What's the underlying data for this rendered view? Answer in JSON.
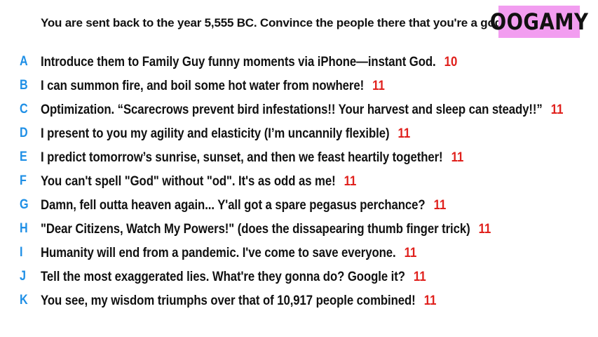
{
  "prompt": "You are sent back to the year 5,555 BC. Convince the people there that you're a god.",
  "logo": "OOGAMY",
  "colors": {
    "letter": "#1e8fe6",
    "score": "#e0201c",
    "logo_background": "#f29df0"
  },
  "answers": [
    {
      "letter": "A",
      "text": "Introduce them to Family Guy funny moments via iPhone—instant God.",
      "score": "10"
    },
    {
      "letter": "B",
      "text": "I can summon fire, and boil some hot water from nowhere!",
      "score": "11"
    },
    {
      "letter": "C",
      "text": "Optimization. “Scarecrows prevent bird infestations!! Your harvest and sleep can steady!!”",
      "score": "11"
    },
    {
      "letter": "D",
      "text": "I present to you my agility and elasticity (I’m uncannily flexible)",
      "score": "11"
    },
    {
      "letter": "E",
      "text": "I predict tomorrow’s sunrise, sunset, and then we feast heartily together!",
      "score": "11"
    },
    {
      "letter": "F",
      "text": "You can't spell \"God\" without \"od\". It's as odd as me!",
      "score": "11"
    },
    {
      "letter": "G",
      "text": "Damn, fell outta heaven again... Y'all got a spare pegasus perchance?",
      "score": "11"
    },
    {
      "letter": "H",
      "text": "\"Dear Citizens, Watch My Powers!\" (does the dissapearing thumb finger trick)",
      "score": "11"
    },
    {
      "letter": "I",
      "text": "Humanity will end from a pandemic. I've come to save everyone.",
      "score": "11"
    },
    {
      "letter": "J",
      "text": "Tell the most exaggerated lies. What're they gonna do? Google it?",
      "score": "11"
    },
    {
      "letter": "K",
      "text": "You see, my wisdom triumphs over that of 10,917 people combined!",
      "score": "11"
    }
  ]
}
